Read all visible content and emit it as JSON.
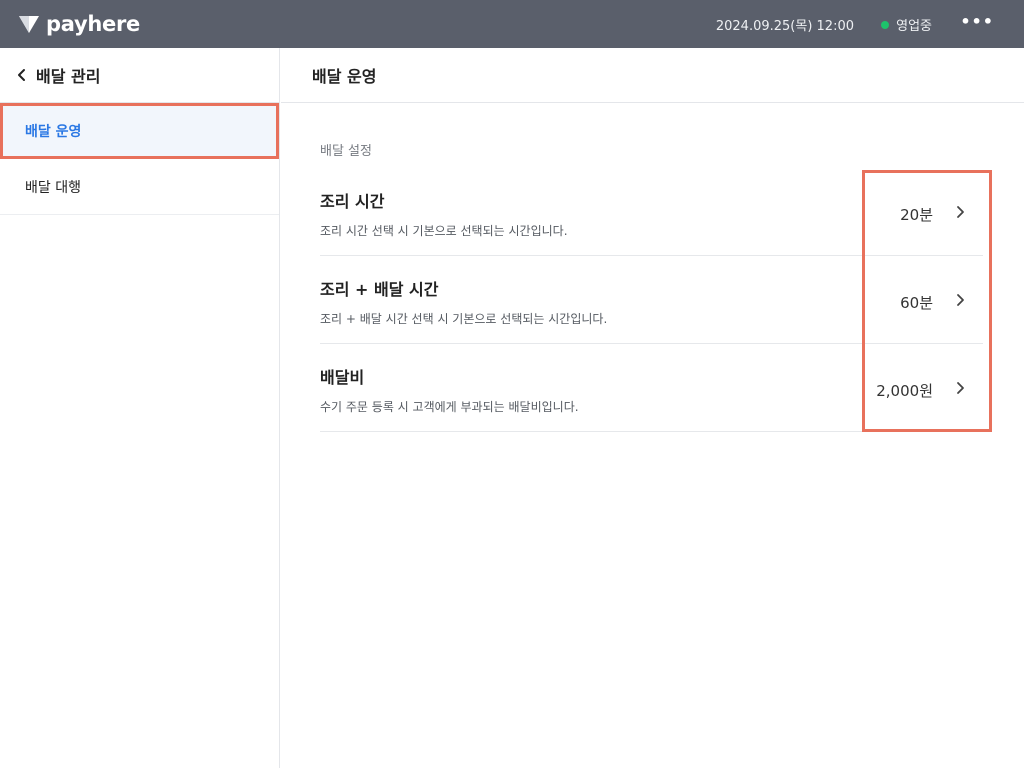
{
  "topbar": {
    "brand": "payhere",
    "datetime": "2024.09.25(목) 12:00",
    "status": "영업중",
    "status_color": "#1ec26b",
    "more": "•••"
  },
  "sidebar": {
    "title": "배달 관리",
    "back_icon": "chevron-left-icon",
    "items": [
      {
        "label": "배달 운영",
        "active": true
      },
      {
        "label": "배달 대행",
        "active": false
      }
    ]
  },
  "main": {
    "title": "배달 운영",
    "section_label": "배달 설정",
    "settings": [
      {
        "name": "조리 시간",
        "description": "조리 시간 선택 시 기본으로 선택되는 시간입니다.",
        "value": "20분"
      },
      {
        "name": "조리 + 배달 시간",
        "description": "조리 + 배달 시간 선택 시 기본으로 선택되는 시간입니다.",
        "value": "60분"
      },
      {
        "name": "배달비",
        "description": "수기 주문 등록 시 고객에게 부과되는 배달비입니다.",
        "value": "2,000원"
      }
    ]
  },
  "colors": {
    "topbar_bg": "#5a5f6b",
    "accent_blue": "#2b78e4",
    "highlight_red": "#e8715c"
  }
}
